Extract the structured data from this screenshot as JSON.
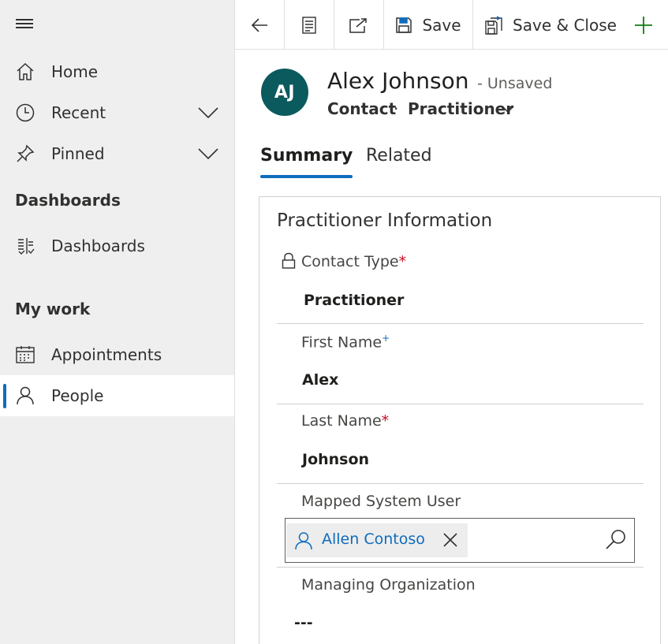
{
  "sidebar": {
    "items": [
      {
        "label": "Home",
        "icon": "home-icon"
      },
      {
        "label": "Recent",
        "icon": "clock-icon"
      },
      {
        "label": "Pinned",
        "icon": "pin-icon"
      },
      {
        "label": "Dashboards",
        "icon": "dashboard-icon"
      },
      {
        "label": "Appointments",
        "icon": "calendar-icon"
      },
      {
        "label": "People",
        "icon": "person-icon"
      }
    ],
    "sections": {
      "dashboards": "Dashboards",
      "my_work": "My work"
    },
    "active_item": "People",
    "accent_color": "#0f6cbd"
  },
  "toolbar": {
    "save_label": "Save",
    "save_close_label": "Save & Close",
    "new_icon_color": "#107c10"
  },
  "record": {
    "initials": "AJ",
    "name": "Alex Johnson",
    "status": "- Unsaved",
    "entity": "Contact",
    "separator": "·",
    "form": "Practitioner",
    "avatar_color": "#0b5a5e"
  },
  "tabs": [
    {
      "label": "Summary",
      "active": true
    },
    {
      "label": "Related",
      "active": false
    }
  ],
  "section": {
    "title": "Practitioner Information",
    "fields": {
      "contact_type": {
        "label": "Contact Type",
        "required_marker": "*",
        "value": "Practitioner"
      },
      "first_name": {
        "label": "First Name",
        "recommended_marker": "+",
        "value": "Alex"
      },
      "last_name": {
        "label": "Last Name",
        "required_marker": "*",
        "value": "Johnson"
      },
      "mapped_user": {
        "label": "Mapped System User",
        "value": "Allen Contoso"
      },
      "managing_org": {
        "label": "Managing Organization",
        "value": "---"
      }
    }
  }
}
